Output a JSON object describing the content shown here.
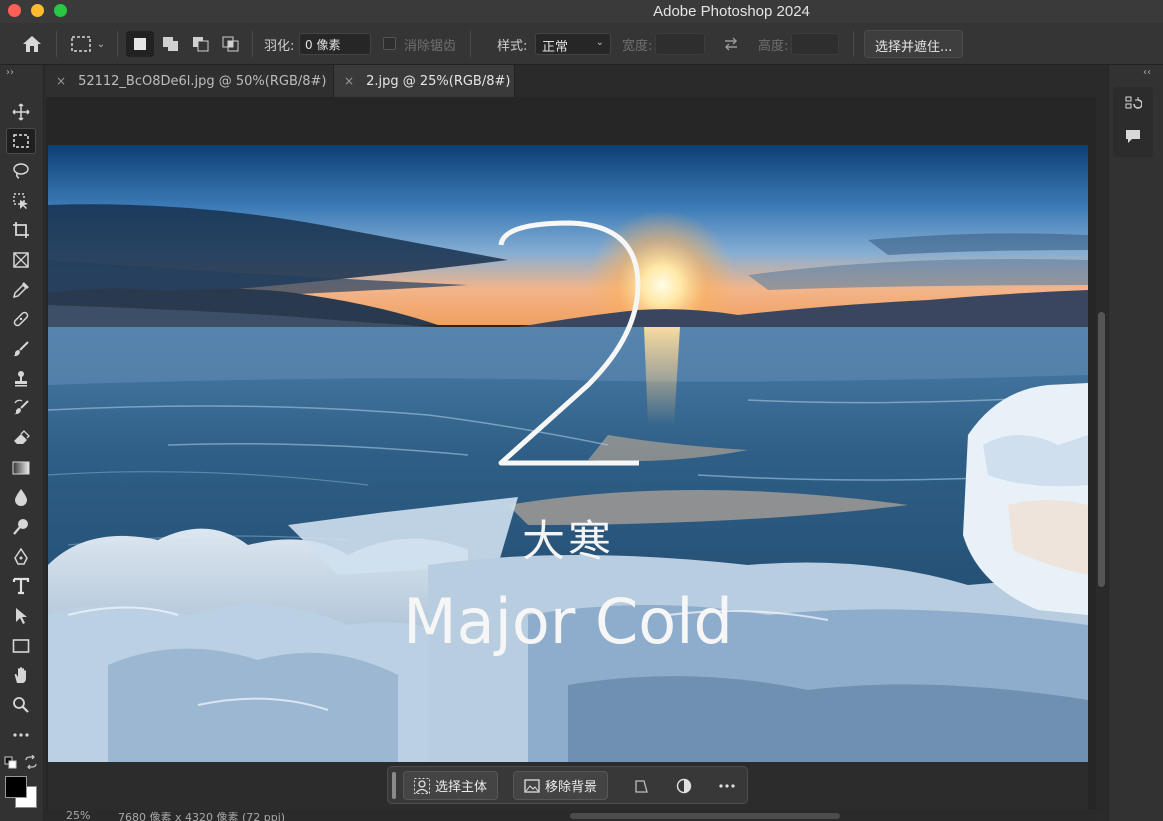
{
  "app": {
    "title": "Adobe Photoshop 2024"
  },
  "options_bar": {
    "feather_label": "羽化:",
    "feather_value": "0 像素",
    "antialias_label": "消除锯齿",
    "style_label": "样式:",
    "style_value": "正常",
    "width_label": "宽度:",
    "height_label": "高度:",
    "select_mask_button": "选择并遮住..."
  },
  "tabs": [
    {
      "label": "52112_BcO8De6l.jpg @ 50%(RGB/8#)",
      "active": false
    },
    {
      "label": "2.jpg @ 25%(RGB/8#)",
      "active": true
    }
  ],
  "tools": [
    "move-tool-icon",
    "marquee-tool-icon",
    "lasso-tool-icon",
    "object-selection-tool-icon",
    "crop-tool-icon",
    "frame-tool-icon",
    "eyedropper-tool-icon",
    "healing-brush-tool-icon",
    "brush-tool-icon",
    "clone-stamp-tool-icon",
    "history-brush-tool-icon",
    "eraser-tool-icon",
    "gradient-tool-icon",
    "blur-tool-icon",
    "dodge-tool-icon",
    "pen-tool-icon",
    "type-tool-icon",
    "path-selection-tool-icon",
    "rectangle-tool-icon",
    "hand-tool-icon",
    "zoom-tool-icon",
    "more-tools-icon"
  ],
  "artwork": {
    "number": "2",
    "title_cn": "大寒",
    "title_en": "Major Cold"
  },
  "contextual_bar": {
    "select_subject": "选择主体",
    "remove_background": "移除背景"
  },
  "status": {
    "zoom": "25%",
    "doc_info": "7680 像素 x 4320 像素 (72 ppi)"
  },
  "colors": {
    "foreground": "#000000",
    "background": "#ffffff"
  }
}
